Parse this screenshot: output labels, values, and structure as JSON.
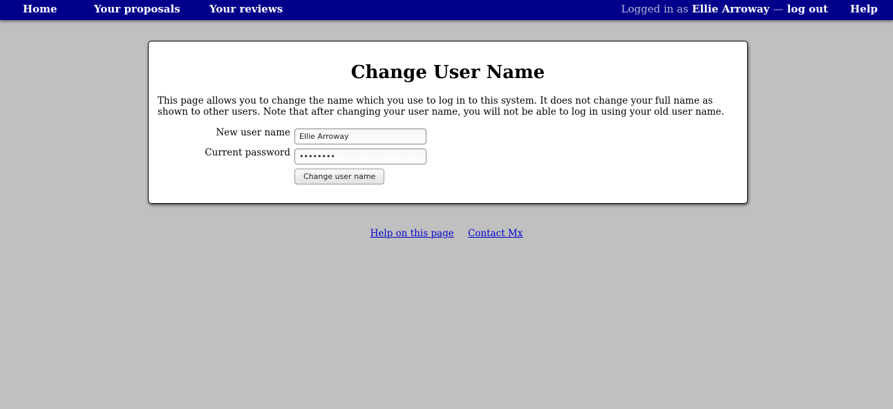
{
  "nav": {
    "home": "Home",
    "proposals": "Your proposals",
    "reviews": "Your reviews",
    "logged_in_prefix": "Logged in as",
    "user": "Ellie Arroway",
    "separator": "—",
    "logout": "log out",
    "help": "Help"
  },
  "page": {
    "title": "Change User Name",
    "intro": "This page allows you to change the name which you use to log in to this system. It does not change your full name as shown to other users. Note that after changing your user name, you will not be able to log in using your old user name."
  },
  "form": {
    "new_user_name_label": "New user name",
    "new_user_name_value": "Ellie Arroway",
    "password_label": "Current password",
    "password_value": "••••••••",
    "submit_label": "Change user name"
  },
  "footer": {
    "help_link": "Help on this page",
    "contact_link": "Contact Mx"
  },
  "colors": {
    "nav_background": "#00008b",
    "page_background": "#c0c0c0",
    "link": "#0000cc"
  }
}
